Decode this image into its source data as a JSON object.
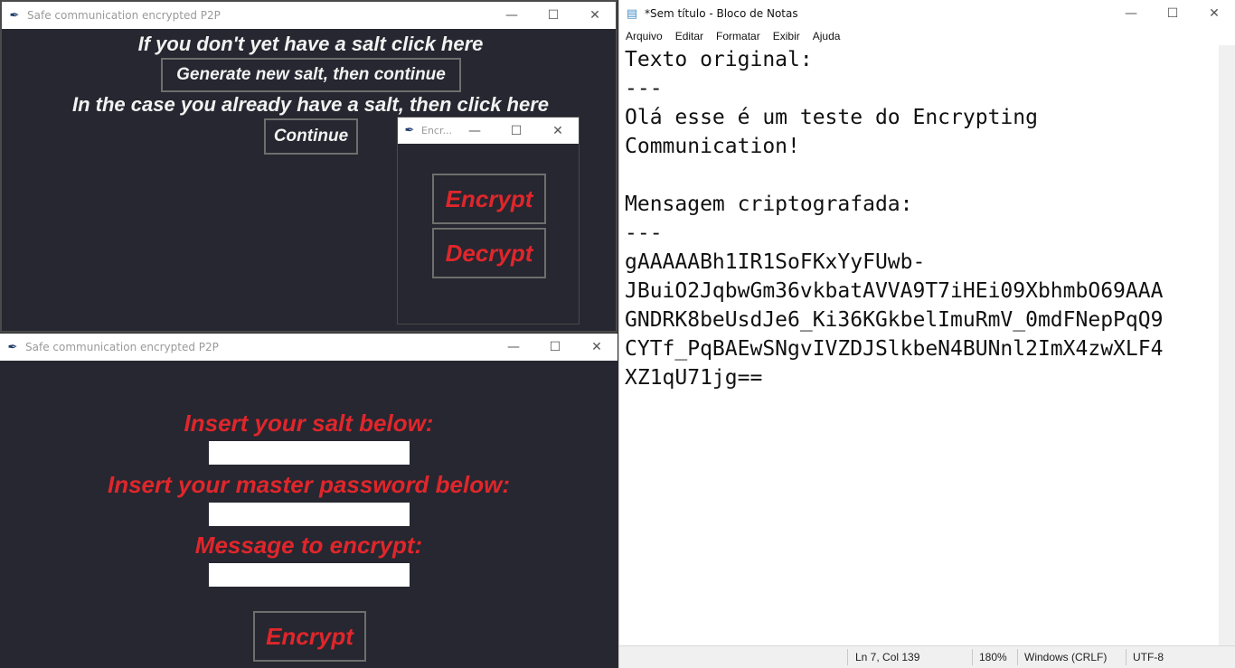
{
  "win1": {
    "title": "Safe communication encrypted P2P",
    "line1": "If you don't yet have a salt click here",
    "gen_button": "Generate new salt, then continue",
    "line2": "In the case you already have a salt, then click here",
    "continue_button": "Continue"
  },
  "win_small": {
    "title": "Encr...",
    "encrypt_button": "Encrypt",
    "decrypt_button": "Decrypt"
  },
  "win2": {
    "title": "Safe communication encrypted P2P",
    "salt_label": "Insert your salt below:",
    "password_label": "Insert your master password below:",
    "message_label": "Message to encrypt:",
    "salt_value": "",
    "password_value": "",
    "message_value": "",
    "encrypt_button": "Encrypt"
  },
  "notepad": {
    "title": "*Sem título - Bloco de Notas",
    "menu": [
      "Arquivo",
      "Editar",
      "Formatar",
      "Exibir",
      "Ajuda"
    ],
    "content": "Texto original:\n---\nOlá esse é um teste do Encrypting\nCommunication!\n\nMensagem criptografada:\n---\ngAAAAABh1IR1SoFKxYyFUwb-\nJBuiO2JqbwGm36vkbatAVVA9T7iHEi09XbhmbO69AAA\nGNDRK8beUsdJe6_Ki36KGkbelImuRmV_0mdFNepPqQ9\nCYTf_PqBAEwSNgvIVZDJSlkbeN4BUNnl2ImX4zwXLF4\nXZ1qU71jg==",
    "status_position": "Ln 7, Col 139",
    "status_zoom": "180%",
    "status_eol": "Windows (CRLF)",
    "status_encoding": "UTF-8"
  },
  "colors": {
    "dark_bg": "#262730",
    "accent_red": "#e0262b"
  }
}
